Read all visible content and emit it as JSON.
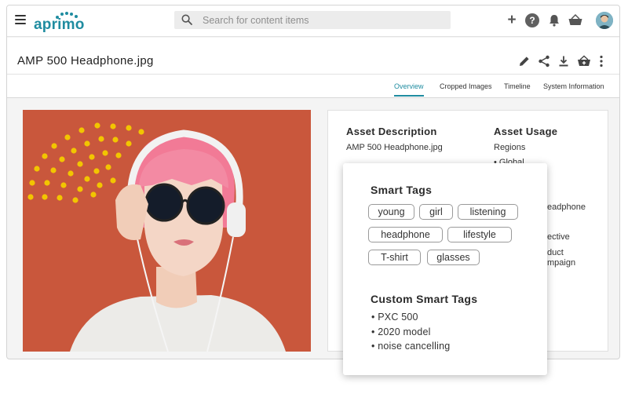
{
  "app": {
    "logo_text": "aprimo"
  },
  "search": {
    "placeholder": "Search for content items"
  },
  "toolbar": {
    "help_label": "?"
  },
  "asset": {
    "title": "AMP 500 Headphone.jpg"
  },
  "tabs": [
    {
      "label": "Overview",
      "active": true
    },
    {
      "label": "Cropped Images",
      "active": false
    },
    {
      "label": "Timeline",
      "active": false
    },
    {
      "label": "System Information",
      "active": false
    }
  ],
  "info": {
    "description_heading": "Asset Description",
    "description_value": "AMP 500 Headphone.jpg",
    "usage_heading": "Asset Usage",
    "usage_regions_label": "Regions",
    "usage_regions_value": "• Global",
    "partial_lines": [
      "eadphone",
      "ective",
      "duct",
      "mpaign"
    ]
  },
  "smart_tags": {
    "heading": "Smart Tags",
    "tags": [
      "young",
      "girl",
      "listening",
      "headphone",
      "lifestyle",
      "T-shirt",
      "glasses"
    ]
  },
  "custom_smart_tags": {
    "heading": "Custom Smart Tags",
    "items": [
      "• PXC 500",
      "• 2020 model",
      "• noise cancelling"
    ]
  },
  "colors": {
    "accent": "#1f8ca0",
    "photo_background": "#c9573c",
    "dots": "#f2c500"
  }
}
